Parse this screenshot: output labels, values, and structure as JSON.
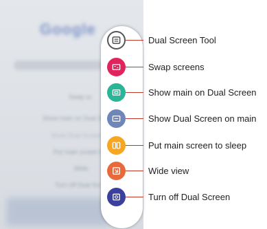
{
  "callouts": [
    {
      "label": "Dual Screen Tool",
      "color": "#ffffff",
      "icon": "dual-screen-tool-icon"
    },
    {
      "label": "Swap screens",
      "color": "#e0245e",
      "icon": "swap-screens-icon"
    },
    {
      "label": "Show main on Dual Screen",
      "color": "#2bb598",
      "icon": "show-main-on-dual-screen-icon"
    },
    {
      "label": "Show Dual Screen on main",
      "color": "#6f86b8",
      "icon": "show-dual-screen-on-main-icon"
    },
    {
      "label": "Put main screen to sleep",
      "color": "#f5a623",
      "icon": "sleep-screen-icon"
    },
    {
      "label": "Wide view",
      "color": "#e86a3a",
      "icon": "wide-view-icon"
    },
    {
      "label": "Turn off Dual Screen",
      "color": "#3b3f9e",
      "icon": "turn-off-dual-screen-icon"
    }
  ],
  "background_text": {
    "logo": "Google",
    "items": [
      "Swap sc",
      "Show main on Dual Scr",
      "Show Dual Screen o",
      "Put main screen to",
      "Wide",
      "Turn off Dual Scr"
    ]
  },
  "accent_line_color": "#c0392b"
}
